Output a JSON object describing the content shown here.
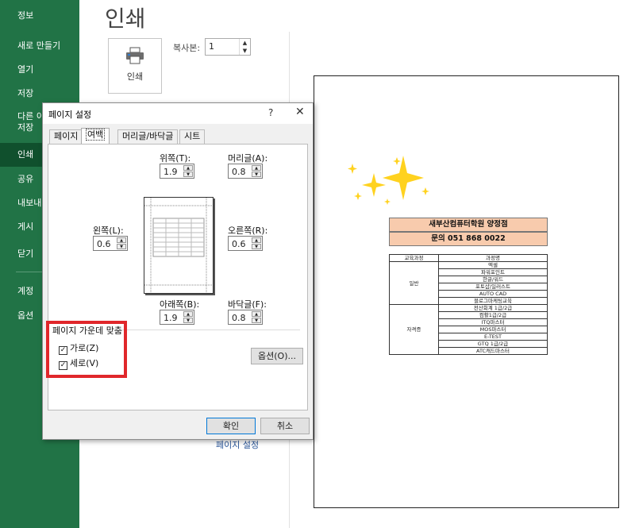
{
  "sidebar": {
    "items": [
      {
        "label": "정보"
      },
      {
        "label": "새로 만들기"
      },
      {
        "label": "열기"
      },
      {
        "label": "저장"
      },
      {
        "label": "다른 이름으로",
        "label2": "저장"
      },
      {
        "label": "인쇄"
      },
      {
        "label": "공유"
      },
      {
        "label": "내보내기"
      },
      {
        "label": "게시"
      },
      {
        "label": "닫기"
      },
      {
        "label": "계정"
      },
      {
        "label": "옵션"
      }
    ],
    "colors": {
      "bg": "#217346",
      "active": "#10502d"
    }
  },
  "main": {
    "title": "인쇄",
    "print_button": "인쇄",
    "copies_label": "복사본:",
    "copies_value": "1",
    "page_setup_link": "페이지 설정"
  },
  "preview": {
    "header1": "새부산컴퓨터학원 양정점",
    "header2": "문의 051 868 0022",
    "table_header": [
      "교육과정",
      "과정명"
    ],
    "groups": [
      {
        "category": "일반",
        "courses": [
          "엑셀",
          "파워포인트",
          "한글/워드",
          "포토샵/일러스트",
          "AUTO CAD",
          "블로그마케팅교육"
        ]
      },
      {
        "category": "자격증",
        "courses": [
          "전산회계 1급/2급",
          "컴활1급/2급",
          "ITQ마스터",
          "MOS마스터",
          "E-TEST",
          "GTQ 1급/2급",
          "ATC캐드마스터"
        ]
      }
    ]
  },
  "dialog": {
    "title": "페이지 설정",
    "help": "?",
    "close": "✕",
    "tabs": [
      "페이지",
      "여백",
      "머리글/바닥글",
      "시트"
    ],
    "active_tab": "여백",
    "fields": {
      "top": {
        "label": "위쪽(T):",
        "value": "1.9"
      },
      "header": {
        "label": "머리글(A):",
        "value": "0.8"
      },
      "left": {
        "label": "왼쪽(L):",
        "value": "0.6"
      },
      "right": {
        "label": "오른쪽(R):",
        "value": "0.6"
      },
      "bottom": {
        "label": "아래쪽(B):",
        "value": "1.9"
      },
      "footer": {
        "label": "바닥글(F):",
        "value": "0.8"
      }
    },
    "center_on_page": {
      "label": "페이지 가운데 맞춤",
      "horizontal": {
        "label": "가로(Z)",
        "checked": true
      },
      "vertical": {
        "label": "세로(V)",
        "checked": true
      }
    },
    "options_button": "옵션(O)...",
    "ok_button": "확인",
    "cancel_button": "취소"
  },
  "highlight_color": "#e0272b"
}
